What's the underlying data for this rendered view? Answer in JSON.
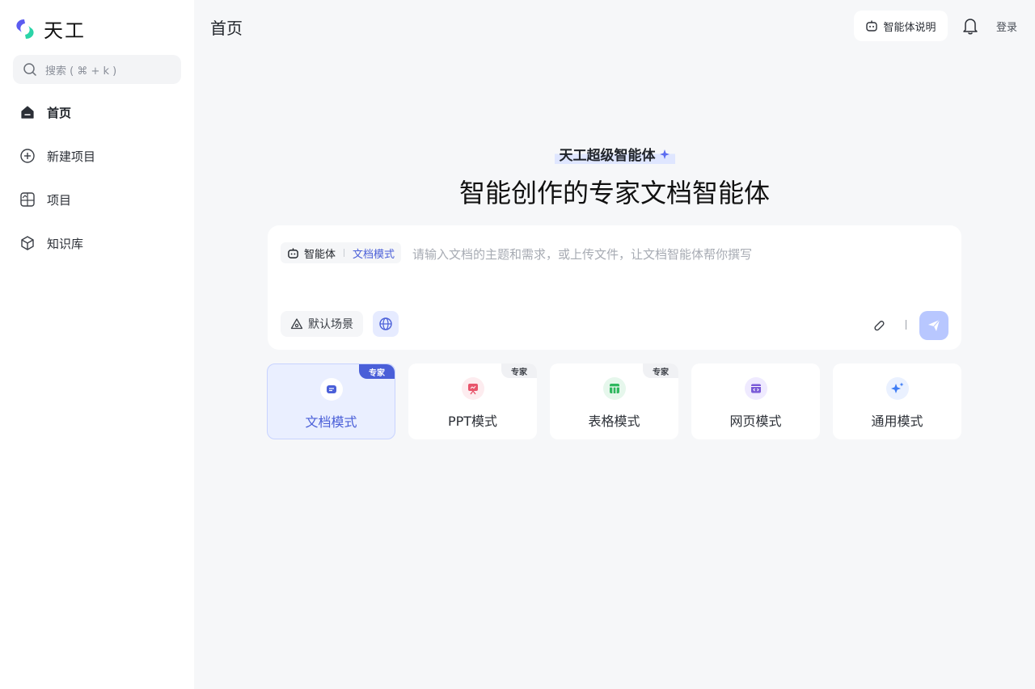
{
  "sidebar": {
    "logo_text": "天工",
    "search_placeholder": "搜索 ( ⌘ + k )",
    "items": [
      {
        "label": "首页",
        "icon": "home-icon"
      },
      {
        "label": "新建项目",
        "icon": "plus-circle-icon"
      },
      {
        "label": "项目",
        "icon": "project-icon"
      },
      {
        "label": "知识库",
        "icon": "cube-icon"
      }
    ]
  },
  "header": {
    "title": "首页",
    "agent_info_label": "智能体说明",
    "login_label": "登录"
  },
  "hero": {
    "badge": "天工超级智能体",
    "title": "智能创作的专家文档智能体"
  },
  "composer": {
    "agent_label": "智能体",
    "mode_label": "文档模式",
    "placeholder": "请输入文档的主题和需求，或上传文件，让文档智能体帮你撰写",
    "scene_label": "默认场景"
  },
  "modes": [
    {
      "label": "文档模式",
      "tag": "专家",
      "active": true,
      "color": "#4a5fd8"
    },
    {
      "label": "PPT模式",
      "tag": "专家",
      "active": false,
      "color": "#e8546b"
    },
    {
      "label": "表格模式",
      "tag": "专家",
      "active": false,
      "color": "#2fb85f"
    },
    {
      "label": "网页模式",
      "tag": "",
      "active": false,
      "color": "#7a5ad8"
    },
    {
      "label": "通用模式",
      "tag": "",
      "active": false,
      "color": "#3d7cf5"
    }
  ],
  "colors": {
    "accent": "#4a5fd8",
    "send_disabled": "#b8c7ff"
  }
}
